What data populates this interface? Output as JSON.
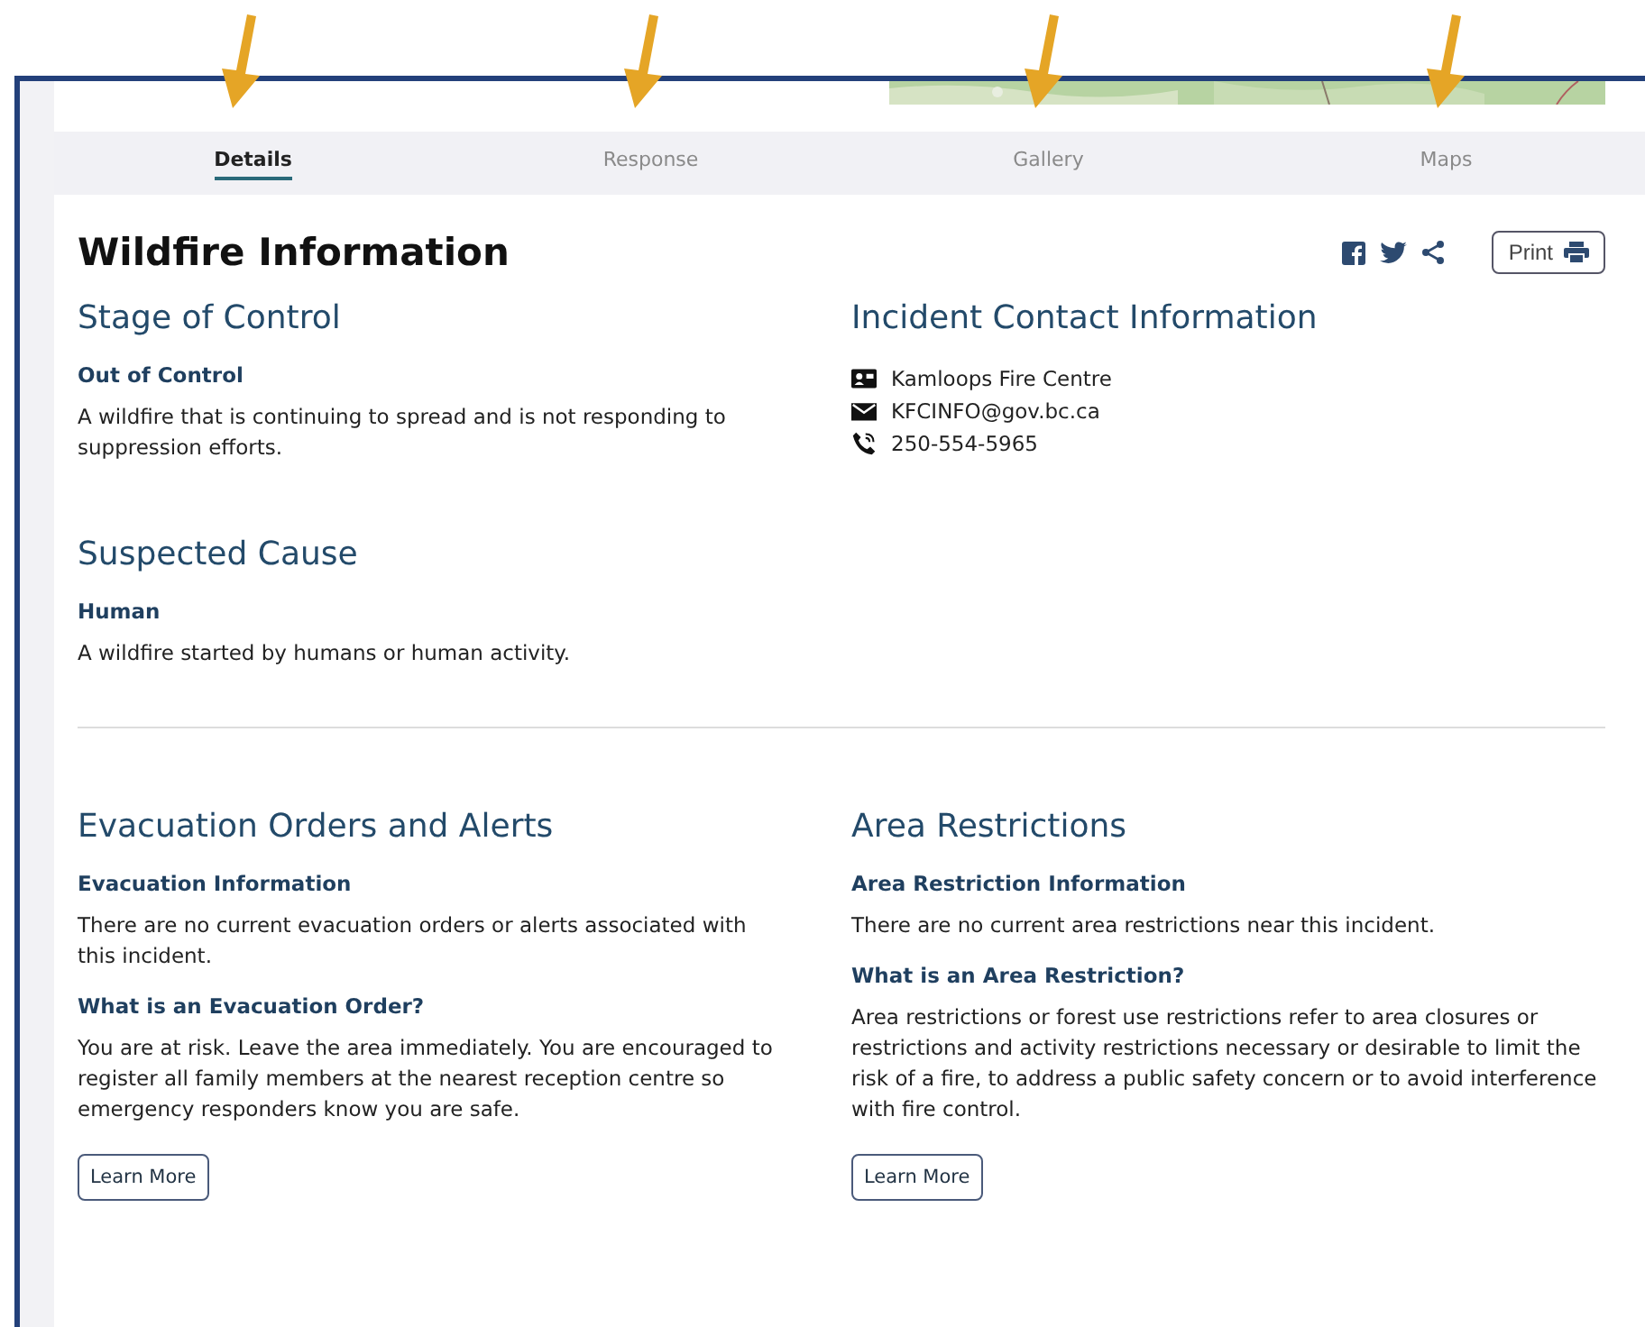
{
  "tabs": [
    {
      "label": "Details",
      "selected": true
    },
    {
      "label": "Response",
      "selected": false
    },
    {
      "label": "Gallery",
      "selected": false
    },
    {
      "label": "Maps",
      "selected": false
    }
  ],
  "title": "Wildfire Information",
  "print_button": "Print",
  "stage_of_control": {
    "heading": "Stage of Control",
    "label": "Out of Control",
    "text": "A wildfire that is continuing to spread and is not responding to suppression efforts."
  },
  "suspected_cause": {
    "heading": "Suspected Cause",
    "label": "Human",
    "text": "A wildfire started by humans or human activity."
  },
  "contact": {
    "heading": "Incident Contact Information",
    "items": [
      {
        "kind": "centre",
        "text": "Kamloops Fire Centre"
      },
      {
        "kind": "email",
        "text": "KFCINFO@gov.bc.ca"
      },
      {
        "kind": "phone",
        "text": "250-554-5965"
      }
    ]
  },
  "evacuation": {
    "heading": "Evacuation Orders and Alerts",
    "label": "Evacuation Information",
    "text": "There are no current evacuation orders or alerts associated with this incident.",
    "question": "What is an Evacuation Order?",
    "answer": "You are at risk. Leave the area immediately. You are encouraged to register all family members at the nearest reception centre so emergency responders know you are safe.",
    "button": "Learn More"
  },
  "restrictions": {
    "heading": "Area Restrictions",
    "label": "Area Restriction Information",
    "text": "There are no current area restrictions near this incident.",
    "question": "What is an Area Restriction?",
    "answer": "Area restrictions or forest use restrictions refer to area closures or restrictions and activity restrictions necessary or desirable to limit the risk of a fire, to address a public safety concern or to avoid interference with fire control.",
    "button": "Learn More"
  }
}
